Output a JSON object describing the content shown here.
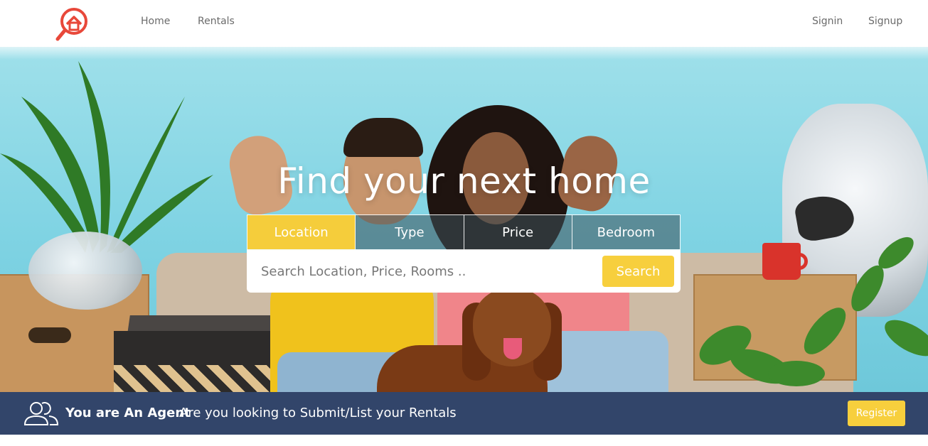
{
  "navbar": {
    "logo_icon": "house-search-logo-icon",
    "links": [
      "Home",
      "Rentals"
    ],
    "auth": [
      "Signin",
      "Signup"
    ]
  },
  "hero": {
    "headline": "Find your next home",
    "tabs": [
      "Location",
      "Type",
      "Price",
      "Bedroom"
    ],
    "active_tab": "Location",
    "search": {
      "placeholder": "Search Location, Price, Rooms ..",
      "value": "",
      "button_label": "Search"
    }
  },
  "agent_banner": {
    "icon": "users-icon",
    "title": "You are An Agent",
    "text": "Are you looking to Submit/List your Rentals",
    "button_label": "Register"
  },
  "colors": {
    "accent_yellow": "#f7cf3d",
    "logo_red": "#e8483a",
    "banner_navy": "#22375f"
  }
}
